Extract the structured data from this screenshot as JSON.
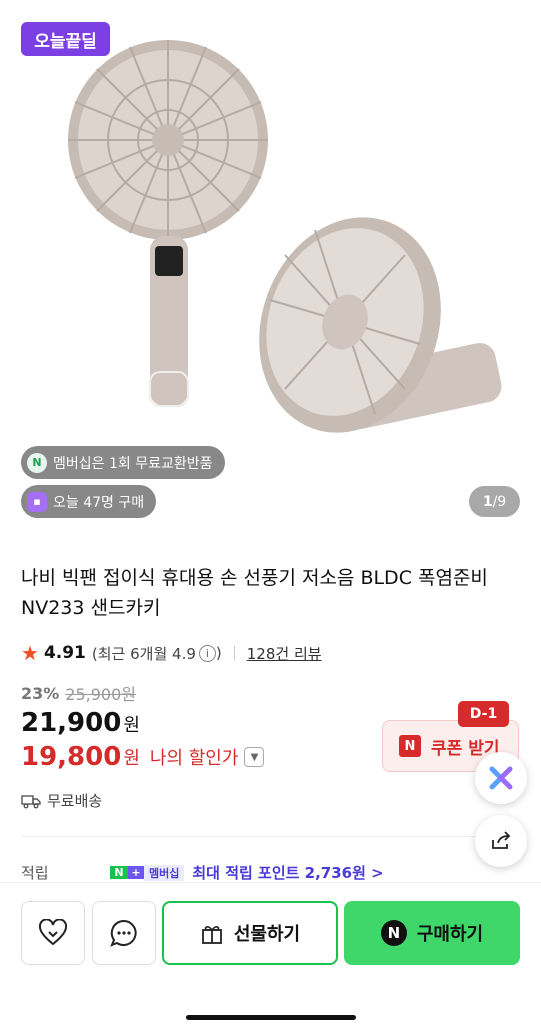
{
  "hero": {
    "badge": "오늘끝딜",
    "chip_membership": "멤버십은 1회 무료교환반품",
    "chip_membership_icon": "N",
    "chip_today": "오늘 47명 구매",
    "pager_current": "1",
    "pager_total": "/9"
  },
  "product": {
    "title": "나비 빅팬 접이식 휴대용 손 선풍기 저소음 BLDC 폭염준비 NV233 샌드카키",
    "rating": "4.91",
    "rating_recent": "(최근 6개월 4.9",
    "review_count": "128건 리뷰",
    "discount_pct": "23%",
    "original_price": "25,900원",
    "price": "21,900",
    "price_unit": "원",
    "my_price": "19,800",
    "my_price_unit": "원",
    "my_price_label": "나의 할인가",
    "shipping": "무료배송"
  },
  "coupon": {
    "dday": "D-1",
    "icon": "N",
    "label": "쿠폰 받기"
  },
  "points": {
    "label": "적립",
    "badge_n": "N",
    "badge_plus": "+",
    "badge_text": "멤버십",
    "text": "최대 적립 포인트 2,736원 >"
  },
  "bottom_bar": {
    "gift_label": "선물하기",
    "buy_icon": "N",
    "buy_label": "구매하기"
  },
  "colors": {
    "accent_purple": "#7b3fe4",
    "sale_red": "#d62b2b",
    "naver_green": "#3fd66a"
  }
}
